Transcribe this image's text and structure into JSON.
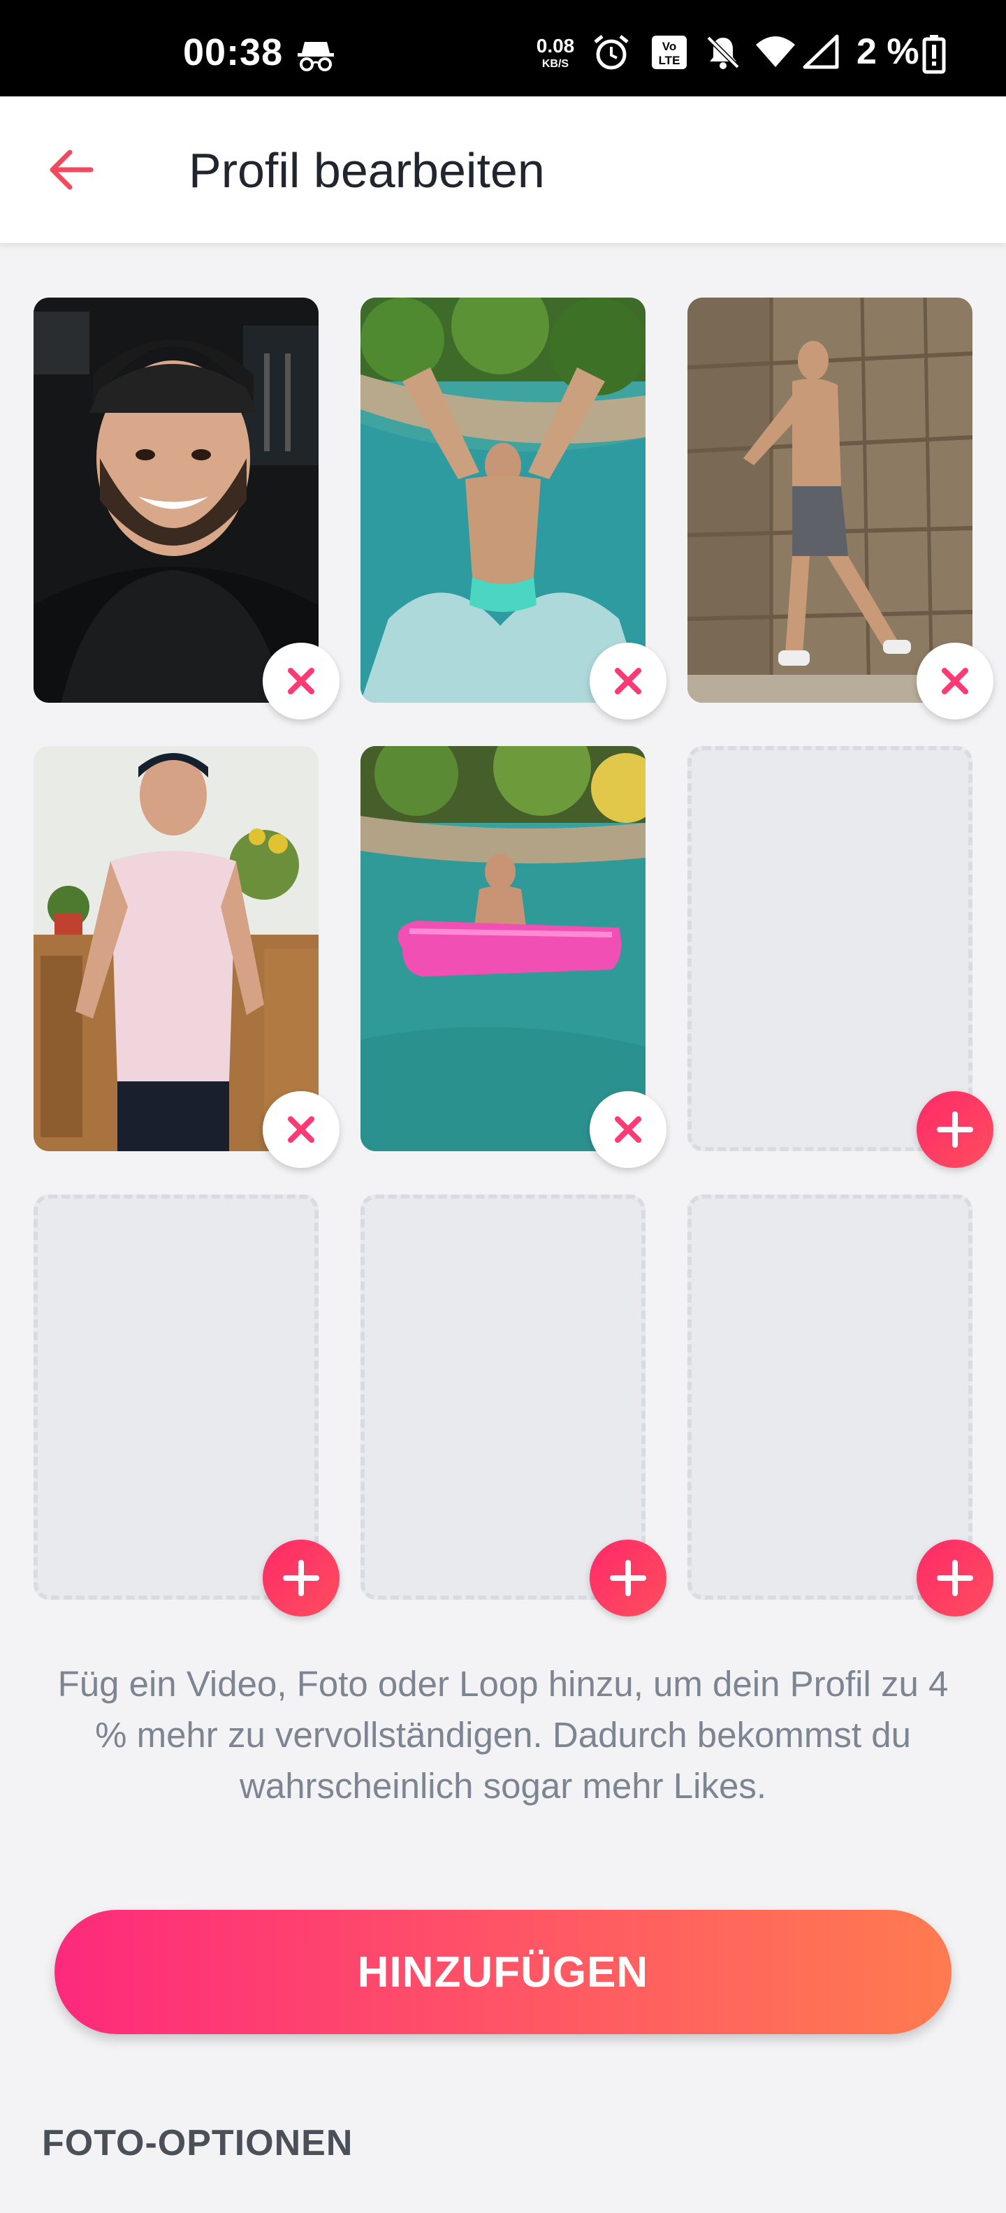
{
  "status_bar": {
    "time": "00:38",
    "net_speed_value": "0.08",
    "net_speed_unit": "KB/S",
    "battery_percent": "2 %",
    "icons": [
      "incognito-icon",
      "alarm-icon",
      "volte-icon",
      "mute-icon",
      "wifi-icon",
      "signal-icon",
      "battery-icon"
    ]
  },
  "header": {
    "back_icon": "arrow-left-icon",
    "title": "Profil bearbeiten"
  },
  "photos": {
    "tiles": [
      {
        "state": "photo",
        "subject": "selfie with cap",
        "action": "remove"
      },
      {
        "state": "photo",
        "subject": "jumping in pool",
        "action": "remove"
      },
      {
        "state": "photo",
        "subject": "posing at stone wall",
        "action": "remove"
      },
      {
        "state": "photo",
        "subject": "pink t-shirt indoors",
        "action": "remove"
      },
      {
        "state": "photo",
        "subject": "pool with pink float",
        "action": "remove"
      },
      {
        "state": "empty",
        "action": "add"
      },
      {
        "state": "empty",
        "action": "add"
      },
      {
        "state": "empty",
        "action": "add"
      },
      {
        "state": "empty",
        "action": "add"
      }
    ]
  },
  "hint": {
    "text": "Füg ein Video, Foto oder Loop hinzu, um dein Profil zu 4 % mehr zu vervollständigen. Dadurch bekommst du wahrscheinlich sogar mehr Likes."
  },
  "add_button": {
    "label": "HINZUFÜGEN"
  },
  "photo_options": {
    "title": "FOTO-OPTIONEN"
  },
  "colors": {
    "accent": "#fd3a73",
    "gradient_start": "#fd2a7b",
    "gradient_end": "#ff7b4f",
    "text_muted": "#7c8591",
    "background": "#f3f3f5"
  }
}
